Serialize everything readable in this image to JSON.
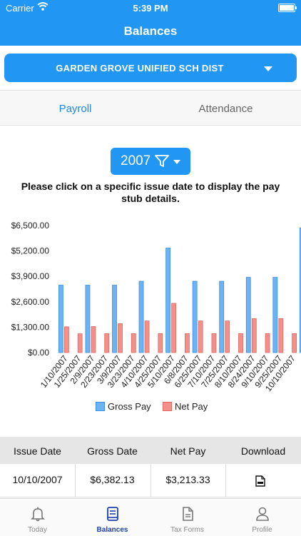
{
  "status_bar": {
    "carrier": "Carrier",
    "time": "5:39 PM"
  },
  "header": {
    "title": "Balances"
  },
  "district": {
    "selected": "GARDEN GROVE UNIFIED SCH DIST"
  },
  "tabs": [
    {
      "label": "Payroll",
      "active": true
    },
    {
      "label": "Attendance",
      "active": false
    }
  ],
  "year_filter": {
    "year": "2007"
  },
  "instructions": "Please click on a specific issue date to display the pay stub details.",
  "chart_data": {
    "type": "bar",
    "categories": [
      "1/10/2007",
      "1/25/2007",
      "2/9/2007",
      "2/23/2007",
      "3/9/2007",
      "3/23/2007",
      "4/10/2007",
      "4/25/2007",
      "5/10/2007",
      "6/8/2007",
      "6/25/2007",
      "7/10/2007",
      "7/25/2007",
      "8/10/2007",
      "8/24/2007",
      "9/10/2007",
      "9/25/2007",
      "10/10/2007"
    ],
    "series": [
      {
        "name": "Gross Pay",
        "values": [
          3450,
          3450,
          3450,
          3650,
          5350,
          3650,
          3650,
          3850,
          3850,
          6382.13
        ]
      },
      {
        "name": "Net Pay",
        "values": [
          1320,
          960,
          1330,
          970,
          1480,
          970,
          1620,
          970,
          2520,
          970,
          1620,
          970,
          1620,
          970,
          1740,
          970,
          1740,
          970,
          3213.33
        ]
      }
    ],
    "ytick_labels": [
      "$0.00",
      "$1,300.00",
      "$2,600.00",
      "$3,900.00",
      "$5,200.00",
      "$6,500.00"
    ],
    "ylim": [
      0,
      6500
    ],
    "legend_position": "bottom"
  },
  "chart_series_colors": {
    "gross_fill": "#6db3f2",
    "gross_stroke": "#3a8ee6",
    "net_fill": "#f4908a",
    "net_stroke": "#e06660"
  },
  "table": {
    "headers": [
      "Issue Date",
      "Gross Date",
      "Net Pay",
      "Download"
    ],
    "rows": [
      {
        "issue_date": "10/10/2007",
        "gross": "$6,382.13",
        "net": "$3,213.33",
        "download_icon": "doc-icon"
      }
    ]
  },
  "tabbar": [
    {
      "label": "Today",
      "icon": "bell-icon",
      "active": false
    },
    {
      "label": "Balances",
      "icon": "book-icon",
      "active": true
    },
    {
      "label": "Tax Forms",
      "icon": "document-icon",
      "active": false
    },
    {
      "label": "Profile",
      "icon": "person-icon",
      "active": false
    }
  ]
}
